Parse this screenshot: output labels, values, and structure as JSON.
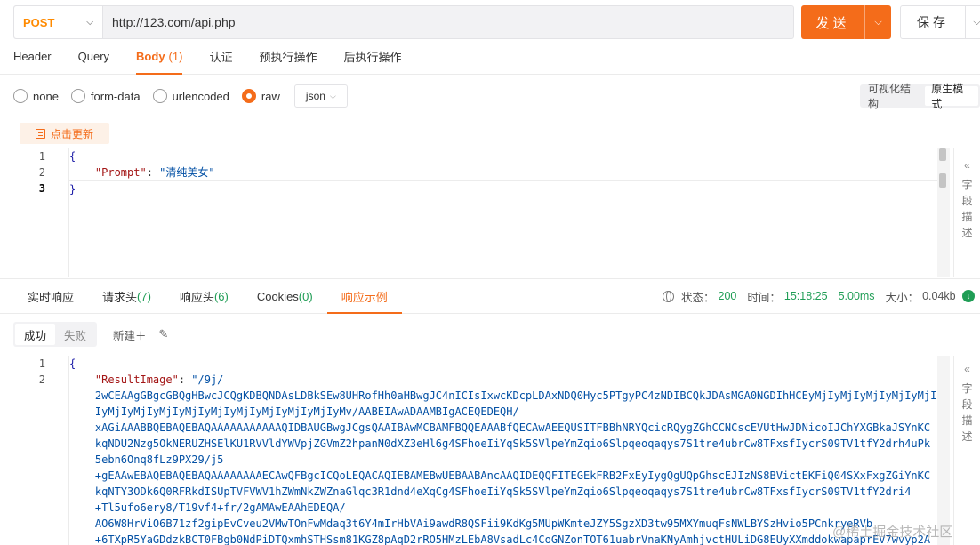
{
  "request": {
    "method": "POST",
    "url": "http://123.com/api.php",
    "send_label": "发送",
    "save_label": "保存"
  },
  "request_tabs": [
    {
      "label": "Header",
      "count": ""
    },
    {
      "label": "Query",
      "count": ""
    },
    {
      "label": "Body",
      "count": "(1)"
    },
    {
      "label": "认证",
      "count": ""
    },
    {
      "label": "预执行操作",
      "count": ""
    },
    {
      "label": "后执行操作",
      "count": ""
    }
  ],
  "body_types": [
    "none",
    "form-data",
    "urlencoded",
    "raw"
  ],
  "body_type_selected": "raw",
  "format_select": "json",
  "view_modes": [
    "可视化结构",
    "原生模式"
  ],
  "update_button": "点击更新",
  "request_body": {
    "line_numbers": [
      "1",
      "2",
      "3"
    ],
    "open_brace": "{",
    "key": "\"Prompt\"",
    "colon": ": ",
    "value": "\"清纯美女\"",
    "close_brace": "}"
  },
  "side_panel": {
    "label_chars": [
      "字",
      "段",
      "描",
      "述"
    ]
  },
  "response_tabs": [
    {
      "label": "实时响应",
      "count": ""
    },
    {
      "label": "请求头",
      "count": "(7)"
    },
    {
      "label": "响应头",
      "count": "(6)"
    },
    {
      "label": "Cookies",
      "count": "(0)"
    },
    {
      "label": "响应示例",
      "count": ""
    }
  ],
  "status": {
    "status_label": "状态：",
    "status_code": "200",
    "time_label": "时间：",
    "time": "15:18:25",
    "duration": "5.00ms",
    "size_label": "大小：",
    "size": "0.04kb"
  },
  "example_tabs": [
    "成功",
    "失败"
  ],
  "new_label": "新建＋",
  "response_body": {
    "line_numbers": [
      "1",
      "2"
    ],
    "open_brace": "{",
    "key": "\"ResultImage\"",
    "colon": ": ",
    "lines": [
      "\"/9j/",
      "2wCEAAgGBgcGBQgHBwcJCQgKDBQNDAsLDBkSEw8UHRofHh0aHBwgJC4nICIsIxwcKDcpLDAxNDQ0Hyc5PTgyPC4zNDIBCQkJDAsMGA0NGDIhHCEyMjIyMjIyMjIyMjIyMjIyMj",
      "IyMjIyMjIyMjIyMjIyMjIyMjIyMjIyMjIyMjIyMv/AABEIAwADAAMBIgACEQEDEQH/",
      "xAGiAAABBQEBAQEBAQAAAAAAAAAAAQIDBAUGBwgJCgsQAAIBAwMCBAMFBQQEAAABfQECAwAEEQUSITFBBhNRYQcicRQygZGhCCNCscEVUtHwJDNicoIJChYXGBkaJSYnKC",
      "kqNDU2Nzg5OkNERUZHSElKU1RVVldYWVpjZGVmZ2hpanN0dXZ3eHl6g4SFhoeIiYqSk5SVlpeYmZqio6Slpqeoqaqys7S1tre4ubrCw8TFxsfIycrS09TV1tfY2drh4uPk",
      "5ebn6Onq8fLz9PX29/j5",
      "+gEAAwEBAQEBAQEBAQAAAAAAAAECAwQFBgcICQoLEQACAQIEBAMEBwUEBAABAncAAQIDEQQFITEGEkFRB2FxEyIygQgUQpGhscEJIzNS8BVictEKFiQ04SXxFxgZGiYnKC",
      "kqNTY3ODk6Q0RFRkdISUpTVFVWV1hZWmNkZWZnaGlqc3R1dnd4eXqCg4SFhoeIiYqSk5SVlpeYmZqio6Slpqeoqaqys7S1tre4ubrCw8TFxsfIycrS09TV1tfY2dri4",
      "+Tl5ufo6ery8/T19vf4+fr/2gAMAwEAAhEDEQA/",
      "AO6W8HrViO6B71zf2gipEvCveu2VMwTOnFwMdaq3t6Y4mIrHbVAi9awdR8QSFii9KdKg5MUpWKmteJZY5SgzXD3tw95MXYmuqFsNWLBYSzHvio5PCnkryeRVb",
      "+6TXpR5YaGDdzkBCT0FBgb0NdPiDTQxmhSTHSsm81KGZ8pAqD2rRO5HMzLEbA8VsadLc4CoGNZonTOT61uabrVnaKNyAmhjvctHULiDG8EUyXXmddokwapaprEV7wvyp2A"
    ]
  },
  "watermark": "@稀土掘金技术社区"
}
